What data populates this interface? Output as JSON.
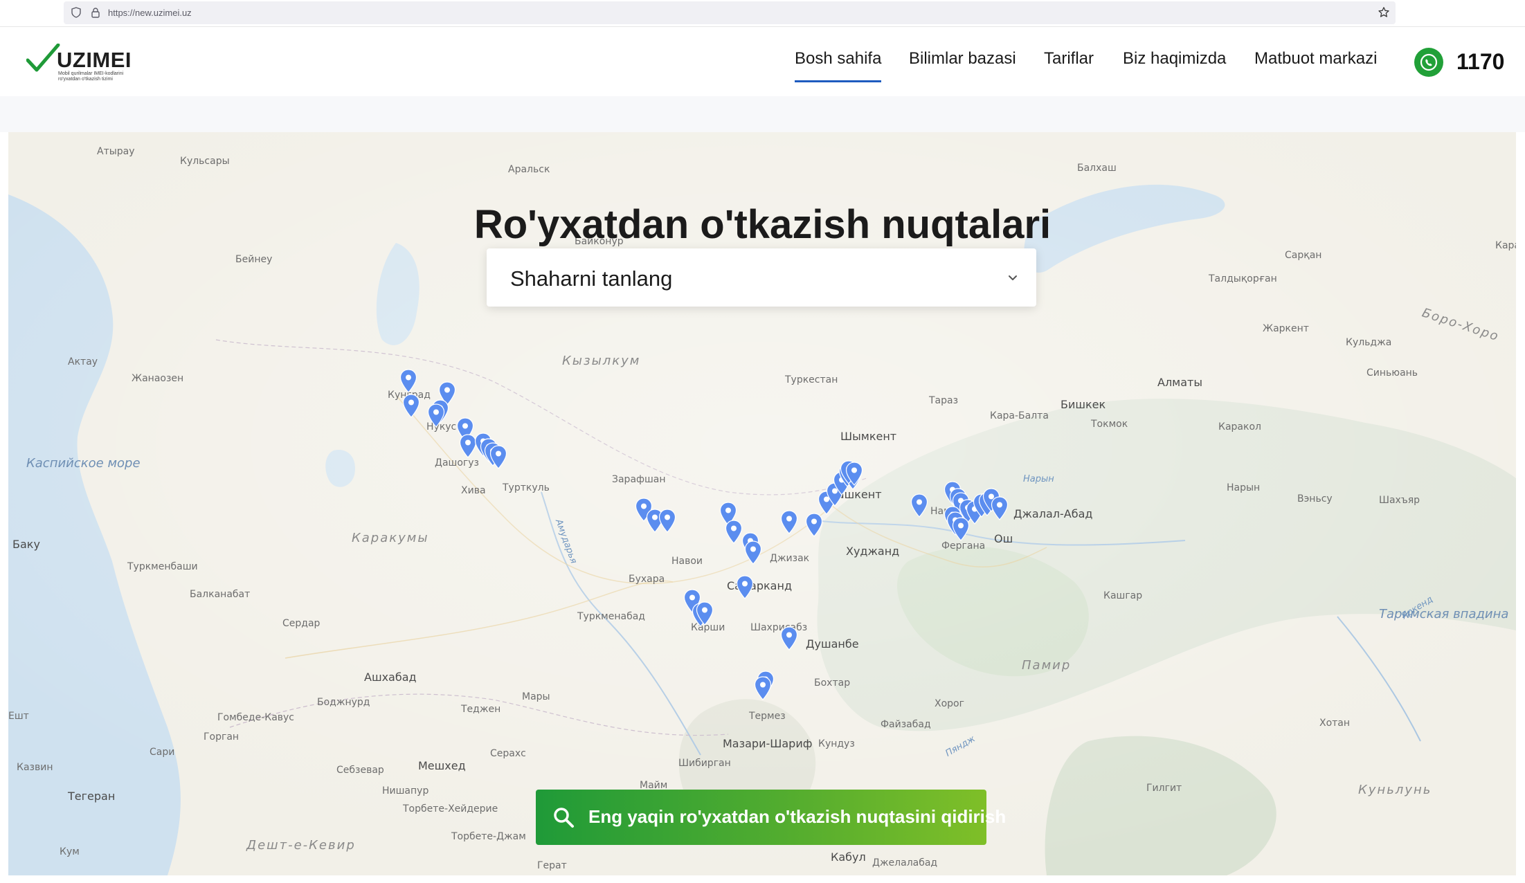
{
  "browser": {
    "url": "https://new.uzimei.uz"
  },
  "header": {
    "logo_text": "UZIMEI",
    "logo_subtitle": "Mobil qurilmalar IMEI-kodlarini ro'yxatdan o'tkazish tizimi",
    "nav": [
      {
        "label": "Bosh sahifa",
        "active": true
      },
      {
        "label": "Bilimlar bazasi",
        "active": false
      },
      {
        "label": "Tariflar",
        "active": false
      },
      {
        "label": "Biz haqimizda",
        "active": false
      },
      {
        "label": "Matbuot markazi",
        "active": false
      }
    ],
    "phone": "1170"
  },
  "main": {
    "title": "Ro'yxatdan o'tkazish nuqtalari",
    "city_select": "Shaharni tanlang",
    "search_button": "Eng yaqin ro'yxatdan o'tkazish nuqtasini qidirish"
  },
  "map": {
    "labels": [
      {
        "text": "Атырау",
        "kind": "city"
      },
      {
        "text": "Кульсары",
        "kind": "city"
      },
      {
        "text": "Аральск",
        "kind": "city"
      },
      {
        "text": "Балхаш",
        "kind": "city"
      },
      {
        "text": "Байконур",
        "kind": "city"
      },
      {
        "text": "Бейнеу",
        "kind": "city"
      },
      {
        "text": "Сарқан",
        "kind": "city"
      },
      {
        "text": "Талдықорған",
        "kind": "city"
      },
      {
        "text": "Жаркент",
        "kind": "city"
      },
      {
        "text": "Кульджа",
        "kind": "city"
      },
      {
        "text": "Актау",
        "kind": "city"
      },
      {
        "text": "Жанаозен",
        "kind": "city"
      },
      {
        "text": "Кызылкум",
        "kind": "desert"
      },
      {
        "text": "Туркестан",
        "kind": "city"
      },
      {
        "text": "Алматы",
        "kind": "big"
      },
      {
        "text": "Синьюань",
        "kind": "city"
      },
      {
        "text": "Кунград",
        "kind": "city"
      },
      {
        "text": "Тараз",
        "kind": "city"
      },
      {
        "text": "Бишкек",
        "kind": "big"
      },
      {
        "text": "Токмок",
        "kind": "city"
      },
      {
        "text": "Кара-Балта",
        "kind": "city"
      },
      {
        "text": "Каракол",
        "kind": "city"
      },
      {
        "text": "Нукус",
        "kind": "city"
      },
      {
        "text": "Шымкент",
        "kind": "big"
      },
      {
        "text": "Каспийское море",
        "kind": "sea"
      },
      {
        "text": "Дашогуз",
        "kind": "city"
      },
      {
        "text": "Зарафшан",
        "kind": "city"
      },
      {
        "text": "Нарын",
        "kind": "city"
      },
      {
        "text": "Хива",
        "kind": "city"
      },
      {
        "text": "Турткуль",
        "kind": "city"
      },
      {
        "text": "Ташкент",
        "kind": "big"
      },
      {
        "text": "Наманган",
        "kind": "city"
      },
      {
        "text": "Джалал-Абад",
        "kind": "big"
      },
      {
        "text": "Вэньсу",
        "kind": "city"
      },
      {
        "text": "Шахъяр",
        "kind": "city"
      },
      {
        "text": "Баку",
        "kind": "big"
      },
      {
        "text": "Каракумы",
        "kind": "desert"
      },
      {
        "text": "Джизак",
        "kind": "city"
      },
      {
        "text": "Худжанд",
        "kind": "big"
      },
      {
        "text": "Фергана",
        "kind": "city"
      },
      {
        "text": "Ош",
        "kind": "big"
      },
      {
        "text": "Туркменбаши",
        "kind": "city"
      },
      {
        "text": "Навои",
        "kind": "city"
      },
      {
        "text": "Бухара",
        "kind": "city"
      },
      {
        "text": "Самарканд",
        "kind": "big"
      },
      {
        "text": "Балканабат",
        "kind": "city"
      },
      {
        "text": "Кашгар",
        "kind": "city"
      },
      {
        "text": "Туркменабад",
        "kind": "city"
      },
      {
        "text": "Сердар",
        "kind": "city"
      },
      {
        "text": "Карши",
        "kind": "city"
      },
      {
        "text": "Шахрисабз",
        "kind": "city"
      },
      {
        "text": "Душанбе",
        "kind": "big"
      },
      {
        "text": "Таримская впадина",
        "kind": "sea"
      },
      {
        "text": "Ашхабад",
        "kind": "big"
      },
      {
        "text": "Памир",
        "kind": "desert"
      },
      {
        "text": "Бохтар",
        "kind": "city"
      },
      {
        "text": "Боджнурд",
        "kind": "city"
      },
      {
        "text": "Мары",
        "kind": "city"
      },
      {
        "text": "Хорог",
        "kind": "city"
      },
      {
        "text": "Гомбеде-Кавус",
        "kind": "city"
      },
      {
        "text": "Теджен",
        "kind": "city"
      },
      {
        "text": "Термез",
        "kind": "city"
      },
      {
        "text": "Файзабад",
        "kind": "city"
      },
      {
        "text": "Хотан",
        "kind": "city"
      },
      {
        "text": "Горган",
        "kind": "city"
      },
      {
        "text": "Сари",
        "kind": "city"
      },
      {
        "text": "Мазари-Шариф",
        "kind": "big"
      },
      {
        "text": "Кундуз",
        "kind": "city"
      },
      {
        "text": "Серахс",
        "kind": "city"
      },
      {
        "text": "Казвин",
        "kind": "city"
      },
      {
        "text": "Себзевар",
        "kind": "city"
      },
      {
        "text": "Мешхед",
        "kind": "big"
      },
      {
        "text": "Шибирган",
        "kind": "city"
      },
      {
        "text": "Гилгит",
        "kind": "city"
      },
      {
        "text": "Нишапур",
        "kind": "city"
      },
      {
        "text": "Тегеран",
        "kind": "big"
      },
      {
        "text": "Торбете-Хейдерие",
        "kind": "city"
      },
      {
        "text": "Куньлунь",
        "kind": "desert"
      },
      {
        "text": "Дешт-е-Кевир",
        "kind": "desert"
      },
      {
        "text": "Торбете-Джам",
        "kind": "city"
      },
      {
        "text": "Кабул",
        "kind": "big"
      },
      {
        "text": "Джелалабад",
        "kind": "city"
      },
      {
        "text": "Герат",
        "kind": "city"
      },
      {
        "text": "Майм",
        "kind": "city"
      },
      {
        "text": "Кум",
        "kind": "city"
      },
      {
        "text": "Амударья",
        "kind": "river"
      },
      {
        "text": "Нарын",
        "kind": "river"
      },
      {
        "text": "Яркенд",
        "kind": "river"
      },
      {
        "text": "Пяндж",
        "kind": "river"
      },
      {
        "text": "Ешт",
        "kind": "city"
      },
      {
        "text": "Боро-Хоро",
        "kind": "desert"
      },
      {
        "text": "Кара",
        "kind": "city"
      }
    ],
    "marker_color": "#5b8def",
    "marker_count": 47
  },
  "colors": {
    "accent_nav": "#1e5bbf",
    "phone_icon": "#21a038",
    "button_start": "#1f9a38",
    "button_end": "#7fbf28"
  }
}
